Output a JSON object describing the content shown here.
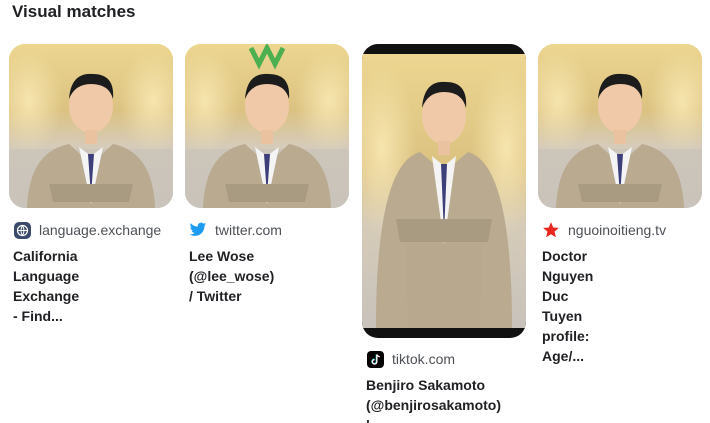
{
  "heading": "Visual matches",
  "results": [
    {
      "source": "language.exchange",
      "title_line1": "California Language",
      "title_line2": "Exchange - Find...",
      "icon": "globe-icon"
    },
    {
      "source": "twitter.com",
      "title_line1": "Lee Wose (@lee_wose)",
      "title_line2": "/ Twitter",
      "icon": "twitter-bird-icon"
    },
    {
      "source": "tiktok.com",
      "title_line1": "Benjiro Sakamoto",
      "title_line2": "(@benjirosakamoto) |...",
      "icon": "tiktok-icon"
    },
    {
      "source": "nguoinoitieng.tv",
      "title_line1": "Doctor Nguyen Duc",
      "title_line2": "Tuyen profile: Age/...",
      "icon": "red-star-icon"
    }
  ],
  "colors": {
    "twitter": "#1d9bf0",
    "star": "#e8271e",
    "text": "#202124",
    "muted": "#4d5156"
  }
}
